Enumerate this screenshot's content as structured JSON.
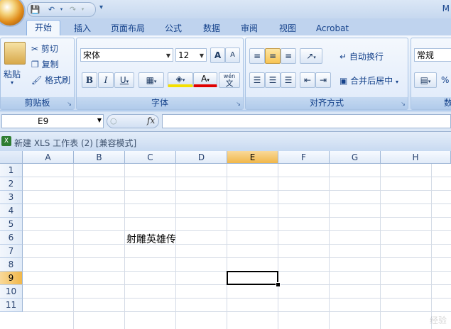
{
  "title_initial": "M",
  "tabs": [
    "开始",
    "插入",
    "页面布局",
    "公式",
    "数据",
    "审阅",
    "视图",
    "Acrobat"
  ],
  "clipboard": {
    "paste": "粘贴",
    "cut": "剪切",
    "copy": "复制",
    "format_painter": "格式刷",
    "label": "剪贴板"
  },
  "font": {
    "name": "宋体",
    "size": "12",
    "bold": "B",
    "italic": "I",
    "underline": "U",
    "grow": "A",
    "shrink": "A",
    "font_color": "A",
    "phonetic": "wén",
    "phonetic_char": "文",
    "label": "字体"
  },
  "alignment": {
    "wrap": "自动换行",
    "merge": "合并后居中",
    "label": "对齐方式"
  },
  "number": {
    "format": "常规",
    "percent": "%",
    "label": "数"
  },
  "name_box": "E9",
  "fx": "fx",
  "workbook_title": "新建 XLS 工作表 (2)  [兼容模式]",
  "columns": [
    "A",
    "B",
    "C",
    "D",
    "E",
    "F",
    "G",
    "H"
  ],
  "rows": [
    "1",
    "2",
    "3",
    "4",
    "5",
    "6",
    "7",
    "8",
    "9",
    "10",
    "11"
  ],
  "cells": {
    "C6": "射雕英雄传"
  },
  "active_cell": "E9",
  "selected_column": "E",
  "selected_row": "9",
  "watermark": "经验"
}
